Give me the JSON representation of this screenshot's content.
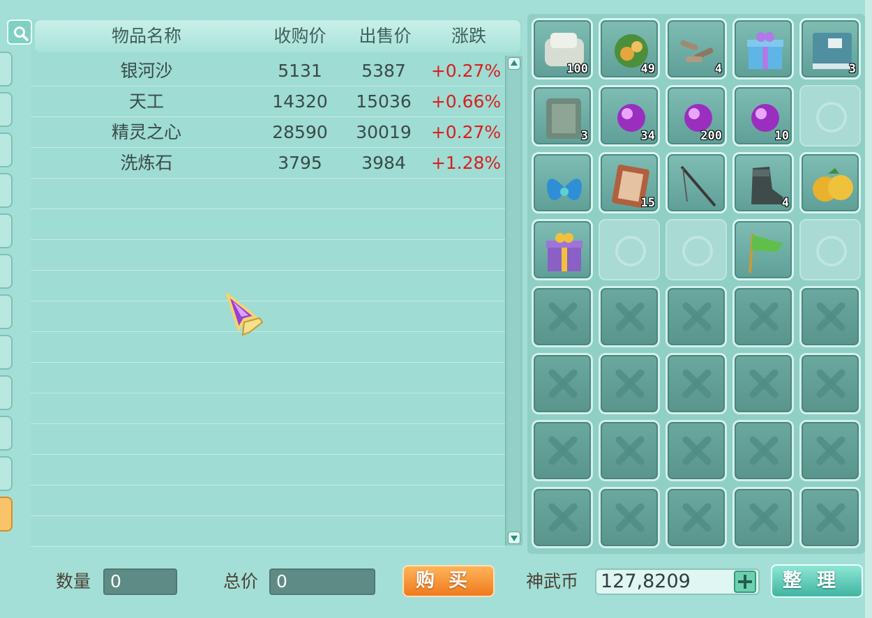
{
  "market": {
    "headers": {
      "name": "物品名称",
      "buy": "收购价",
      "sell": "出售价",
      "change": "涨跌"
    },
    "rows": [
      {
        "name": "银河沙",
        "buy": "5131",
        "sell": "5387",
        "change": "+0.27%"
      },
      {
        "name": "天工",
        "buy": "14320",
        "sell": "15036",
        "change": "+0.66%"
      },
      {
        "name": "精灵之心",
        "buy": "28590",
        "sell": "30019",
        "change": "+0.27%"
      },
      {
        "name": "洗炼石",
        "buy": "3795",
        "sell": "3984",
        "change": "+1.28%"
      }
    ]
  },
  "inventory": {
    "slots": [
      {
        "state": "filled",
        "icon": "cloth-bundle-icon",
        "qty": "100"
      },
      {
        "state": "filled",
        "icon": "herb-icon",
        "qty": "49"
      },
      {
        "state": "filled",
        "icon": "scrap-pile-icon",
        "qty": "4"
      },
      {
        "state": "filled",
        "icon": "gift-box-blue-icon",
        "qty": ""
      },
      {
        "state": "filled",
        "icon": "book-icon",
        "qty": "3"
      },
      {
        "state": "filled",
        "icon": "stone-tablet-icon",
        "qty": "3"
      },
      {
        "state": "filled",
        "icon": "purple-orb-icon",
        "qty": "34"
      },
      {
        "state": "filled",
        "icon": "purple-orb-icon",
        "qty": "200"
      },
      {
        "state": "filled",
        "icon": "purple-orb-icon",
        "qty": "10"
      },
      {
        "state": "empty"
      },
      {
        "state": "filled",
        "icon": "blue-wings-icon",
        "qty": ""
      },
      {
        "state": "filled",
        "icon": "red-book-icon",
        "qty": "15"
      },
      {
        "state": "filled",
        "icon": "fishing-rod-icon",
        "qty": ""
      },
      {
        "state": "filled",
        "icon": "boot-icon",
        "qty": "4"
      },
      {
        "state": "filled",
        "icon": "orange-fruit-icon",
        "qty": ""
      },
      {
        "state": "filled",
        "icon": "gift-box-purple-icon",
        "qty": ""
      },
      {
        "state": "empty"
      },
      {
        "state": "empty"
      },
      {
        "state": "filled",
        "icon": "green-flag-icon",
        "qty": ""
      },
      {
        "state": "empty"
      }
    ],
    "locked_count": 20
  },
  "bottom": {
    "qty_label": "数量",
    "qty_value": "0",
    "total_label": "总价",
    "total_value": "0",
    "buy_label": "购买",
    "currency_label": "神武币",
    "currency_value": "127,8209",
    "sort_label": "整理"
  },
  "colors": {
    "price_up": "#d81f1f",
    "panel": "#a3dfd6"
  }
}
